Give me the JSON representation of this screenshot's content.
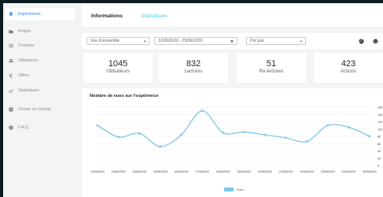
{
  "sidebar": {
    "items": [
      {
        "label": "Expériences",
        "icon": "pin-icon",
        "active": true
      },
      {
        "label": "Projets",
        "icon": "folder-icon",
        "active": false
      },
      {
        "label": "Comptes",
        "icon": "list-icon",
        "active": false
      },
      {
        "label": "Utilisateurs",
        "icon": "users-icon",
        "active": false
      },
      {
        "label": "Offres",
        "icon": "euro-icon",
        "active": false
      },
      {
        "label": "Statistiques",
        "icon": "chart-icon",
        "active": false
      },
      {
        "label": "Choisir un compte",
        "icon": "account-switch-icon",
        "active": false
      },
      {
        "label": "F.A.Q.",
        "icon": "help-icon",
        "active": false
      }
    ]
  },
  "tabs": [
    {
      "label": "Informations",
      "active": true
    },
    {
      "label": "Statistiques",
      "active": false
    }
  ],
  "filters": {
    "view": "Vue d'ensemble",
    "date_range": "12/06/2020 - 25/06/2020",
    "granularity": "Par jour"
  },
  "kpis": [
    {
      "value": "1045",
      "label": "Utilisateurs"
    },
    {
      "value": "832",
      "label": "Lectures"
    },
    {
      "value": "51",
      "label": "Re-lectures"
    },
    {
      "value": "423",
      "label": "Actions"
    }
  ],
  "colors": {
    "accent": "#56ccf2",
    "active_text": "#2f80ed",
    "line": "#7ec6ee"
  },
  "chart_data": {
    "type": "line",
    "title": "Nombre de vues sur l'expérience",
    "categories": [
      "12/06/2020",
      "13/06/2020",
      "14/06/2020",
      "15/06/2020",
      "16/06/2020",
      "17/06/2020",
      "18/06/2020",
      "19/06/2020",
      "20/06/2020",
      "21/06/2020",
      "22/06/2020",
      "23/06/2020",
      "24/06/2020",
      "25/06/2020"
    ],
    "series": [
      {
        "name": "Vues",
        "values": [
          110,
          78,
          88,
          52,
          84,
          150,
          90,
          92,
          84,
          76,
          66,
          110,
          105,
          80
        ]
      }
    ],
    "ylim": [
      0,
      160
    ],
    "yticks": [
      0,
      20,
      40,
      60,
      80,
      100,
      120,
      140,
      160
    ],
    "grid": "horizontal",
    "legend": "bottom-center"
  }
}
